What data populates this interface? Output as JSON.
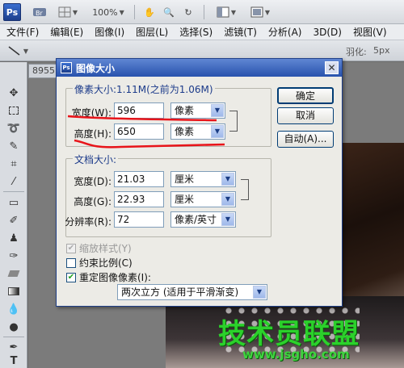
{
  "app": {
    "logo": "Ps",
    "zoom": "100%",
    "menu": [
      "文件(F)",
      "编辑(E)",
      "图像(I)",
      "图层(L)",
      "选择(S)",
      "滤镜(T)",
      "分析(A)",
      "3D(D)",
      "视图(V)"
    ],
    "options_bar": {
      "feather_label": "羽化:",
      "feather_value": "5px"
    },
    "doc_tab": "8955"
  },
  "dialog": {
    "title": "图像大小",
    "close": "✕",
    "pixel_dimensions": {
      "legend": "像素大小:1.11M(之前为1.06M)",
      "width_label": "宽度(W):",
      "width_value": "596",
      "width_unit": "像素",
      "height_label": "高度(H):",
      "height_value": "650",
      "height_unit": "像素"
    },
    "document_size": {
      "legend": "文档大小:",
      "width_label": "宽度(D):",
      "width_value": "21.03",
      "width_unit": "厘米",
      "height_label": "高度(G):",
      "height_value": "22.93",
      "height_unit": "厘米",
      "resolution_label": "分辨率(R):",
      "resolution_value": "72",
      "resolution_unit": "像素/英寸"
    },
    "options": {
      "scale_styles": "缩放样式(Y)",
      "constrain": "约束比例(C)",
      "resample": "重定图像像素(I):",
      "resample_method": "两次立方 (适用于平滑渐变)"
    },
    "buttons": {
      "ok": "确定",
      "cancel": "取消",
      "auto": "自动(A)..."
    }
  },
  "watermark": {
    "text": "技术员联盟",
    "url": "www.jsgho.com"
  },
  "colors": {
    "annotation_red": "#e8141a",
    "title_blue": "#2852ad",
    "watermark_green": "#2bd12b"
  }
}
